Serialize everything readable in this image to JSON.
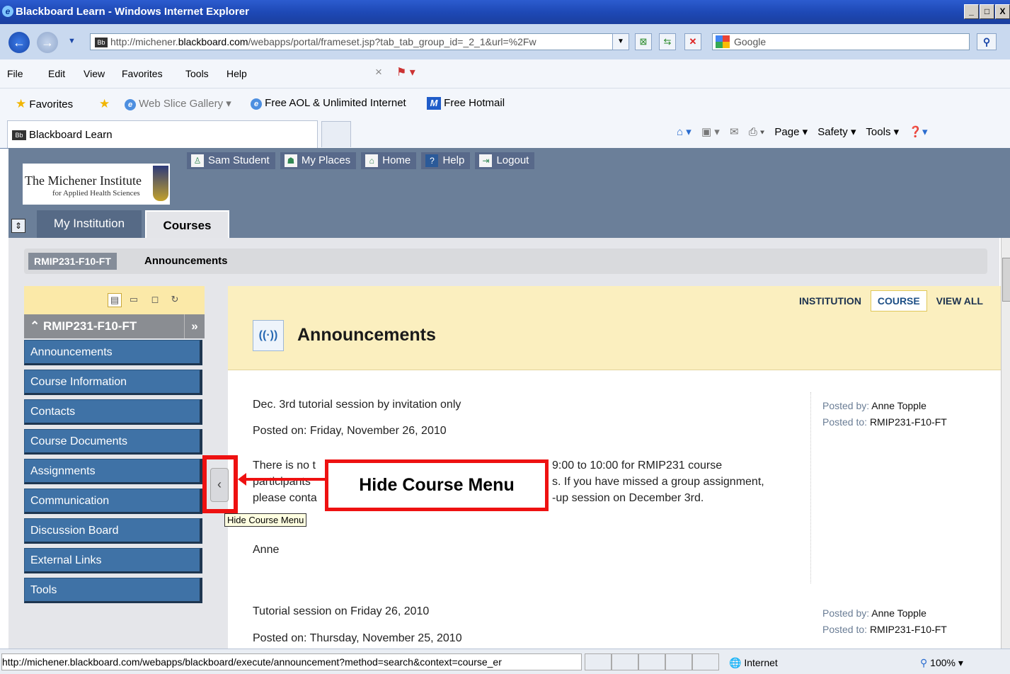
{
  "browser": {
    "title": "Blackboard Learn - Windows Internet Explorer",
    "url": "http://michener.blackboard.com/webapps/portal/frameset.jsp?tab_tab_group_id=_2_1&url=%2Fw",
    "url_prefix": "http://michener.",
    "url_domain": "blackboard.com",
    "url_rest": "/webapps/portal/frameset.jsp?tab_tab_group_id=_2_1&url=%2Fw",
    "search_provider": "Google",
    "menu": [
      "File",
      "Edit",
      "View",
      "Favorites",
      "Tools",
      "Help"
    ],
    "favorites": {
      "label": "Favorites",
      "items": [
        "Web Slice Gallery ▾",
        "Free AOL & Unlimited Internet",
        "Free Hotmail"
      ]
    },
    "tab_title": "Blackboard Learn",
    "command_bar": [
      "Page ▾",
      "Safety ▾",
      "Tools ▾"
    ],
    "status_url": "http://michener.blackboard.com/webapps/blackboard/execute/announcement?method=search&context=course_er",
    "status_zone": "Internet",
    "zoom": "100%"
  },
  "bb": {
    "logo_line1": "The Michener Institute",
    "logo_line2": "for Applied Health Sciences",
    "topnav": [
      "Sam Student",
      "My Places",
      "Home",
      "Help",
      "Logout"
    ],
    "tabs": [
      "My Institution",
      "Courses"
    ],
    "breadcrumb": [
      "RMIP231-F10-FT",
      "Announcements"
    ],
    "course_menu": {
      "title": "RMIP231-F10-FT",
      "items": [
        "Announcements",
        "Course Information",
        "Contacts",
        "Course Documents",
        "Assignments",
        "Communication",
        "Discussion Board",
        "External Links",
        "Tools"
      ]
    },
    "view_tabs": [
      "INSTITUTION",
      "COURSE",
      "VIEW ALL"
    ],
    "page_title": "Announcements",
    "announcements": [
      {
        "title": "Dec. 3rd tutorial session by invitation only",
        "posted_on": "Posted on: Friday, November 26, 2010",
        "line1a": "There is no t",
        "line1b": "9:00 to 10:00 for RMIP231 course",
        "line2a": "participants",
        "line2b": "s. If you have missed a group assignment,",
        "line3a": "please conta",
        "line3b": "-up session on December 3rd.",
        "signature": "Anne",
        "posted_by_label": "Posted by:",
        "posted_by": "Anne Topple",
        "posted_to_label": "Posted to:",
        "posted_to": "RMIP231-F10-FT"
      },
      {
        "title": "Tutorial session on Friday 26, 2010",
        "posted_on": "Posted on: Thursday, November 25, 2010",
        "posted_by_label": "Posted by:",
        "posted_by": "Anne Topple",
        "posted_to_label": "Posted to:",
        "posted_to": "RMIP231-F10-FT"
      }
    ]
  },
  "annotation": {
    "callout": "Hide Course Menu",
    "tooltip": "Hide Course Menu"
  }
}
